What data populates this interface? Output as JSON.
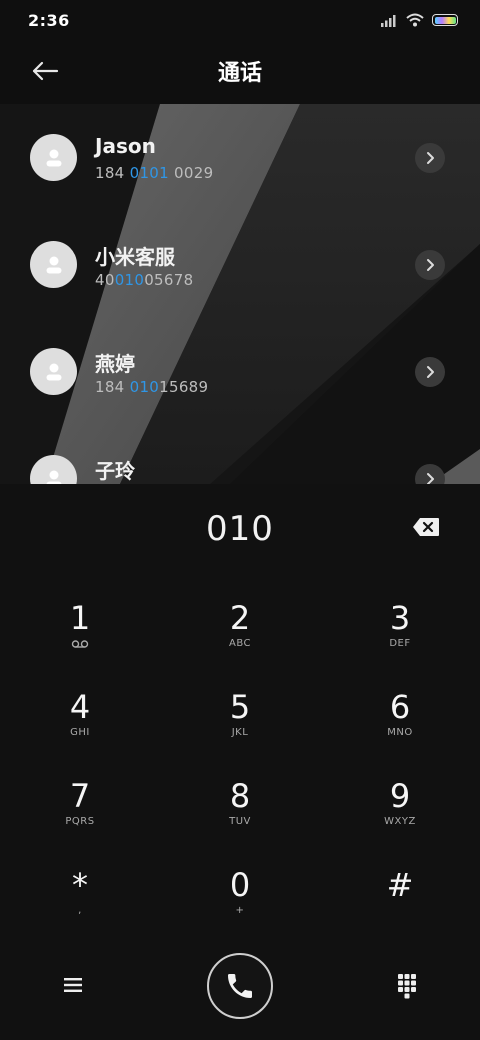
{
  "status": {
    "time": "2:36"
  },
  "header": {
    "title": "通话"
  },
  "results": [
    {
      "name": "Jason",
      "number_parts": [
        "184 ",
        "0101",
        " 0029"
      ]
    },
    {
      "name": "小米客服",
      "number_parts": [
        "40",
        "010",
        "05678"
      ]
    },
    {
      "name": "燕婷",
      "number_parts": [
        "184 ",
        "010",
        "15689"
      ]
    },
    {
      "name": "子玲",
      "number_parts": [
        "",
        "",
        ""
      ]
    }
  ],
  "dialer": {
    "input_value": "010",
    "keys": [
      {
        "digit": "1",
        "letters": ""
      },
      {
        "digit": "2",
        "letters": "ABC"
      },
      {
        "digit": "3",
        "letters": "DEF"
      },
      {
        "digit": "4",
        "letters": "GHI"
      },
      {
        "digit": "5",
        "letters": "JKL"
      },
      {
        "digit": "6",
        "letters": "MNO"
      },
      {
        "digit": "7",
        "letters": "PQRS"
      },
      {
        "digit": "8",
        "letters": "TUV"
      },
      {
        "digit": "9",
        "letters": "WXYZ"
      },
      {
        "digit": "*",
        "letters": ","
      },
      {
        "digit": "0",
        "letters": "+"
      },
      {
        "digit": "#",
        "letters": ""
      }
    ]
  },
  "colors": {
    "highlight": "#2f96e6",
    "background": "#0f0f0f"
  },
  "icons": {
    "back": "arrow-left-icon",
    "backspace": "backspace-icon",
    "voicemail": "voicemail-icon",
    "menu": "hamburger-menu-icon",
    "call": "phone-icon",
    "keypad": "keypad-icon",
    "chevron": "chevron-right-icon",
    "avatar": "person-icon"
  }
}
